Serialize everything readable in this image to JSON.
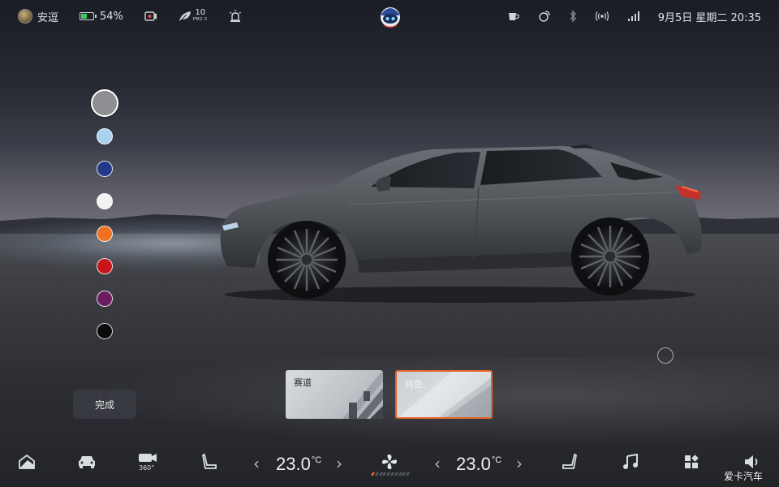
{
  "status_bar": {
    "user_name": "安逗",
    "battery_percent": "54%",
    "battery_level": 0.54,
    "aqi_value": "10",
    "aqi_unit": "PM2.5",
    "datetime": "9月5日 星期二 20:35"
  },
  "color_picker": {
    "selected_index": 0,
    "swatches": [
      {
        "name": "gray",
        "color": "#8e8f93"
      },
      {
        "name": "light-blue",
        "color": "#a9d2f0"
      },
      {
        "name": "navy",
        "color": "#213a87"
      },
      {
        "name": "white",
        "color": "#f2f2f2"
      },
      {
        "name": "orange",
        "color": "#ee7122"
      },
      {
        "name": "red",
        "color": "#c8141b"
      },
      {
        "name": "purple",
        "color": "#6b1c5e"
      },
      {
        "name": "black",
        "color": "#0a0a0a"
      }
    ]
  },
  "done_label": "完成",
  "themes": [
    {
      "label": "赛道",
      "selected": false
    },
    {
      "label": "纯色",
      "selected": true
    }
  ],
  "climate": {
    "left_temp": "23.0",
    "right_temp": "23.0",
    "unit": "°C",
    "fan_level": 1,
    "fan_max": 10
  },
  "dock_icons": [
    "home-icon",
    "car-icon",
    "camera-360-icon",
    "seat-left-icon",
    "fan-icon",
    "seat-right-icon",
    "music-icon",
    "apps-icon",
    "volume-icon"
  ],
  "camera_label": "360°",
  "watermark": "爱卡汽车",
  "colors": {
    "accent": "#e8642c",
    "battery_green": "#3ccf5c",
    "car_body": "#55595e"
  }
}
